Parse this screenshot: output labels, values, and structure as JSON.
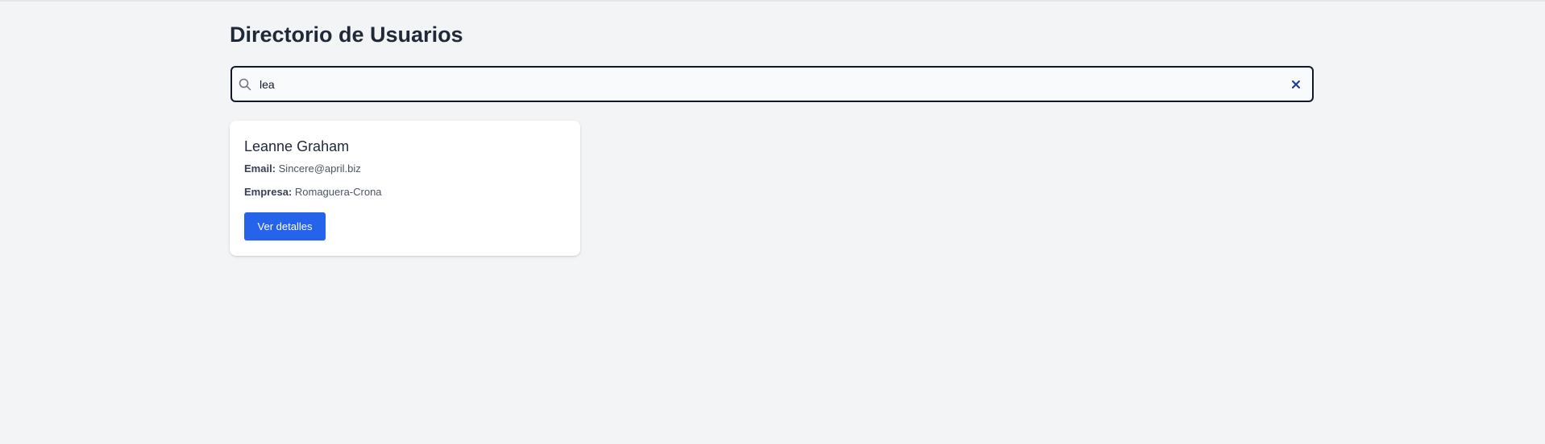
{
  "page": {
    "title": "Directorio de Usuarios"
  },
  "search": {
    "value": "lea",
    "icon": "search-icon",
    "clear_icon": "close-icon"
  },
  "results": [
    {
      "name": "Leanne Graham",
      "email_label": "Email:",
      "email": "Sincere@april.biz",
      "company_label": "Empresa:",
      "company": "Romaguera-Crona",
      "button_label": "Ver detalles"
    }
  ],
  "colors": {
    "background": "#f3f4f6",
    "primary_button": "#2563eb",
    "text_dark": "#1f2937"
  }
}
